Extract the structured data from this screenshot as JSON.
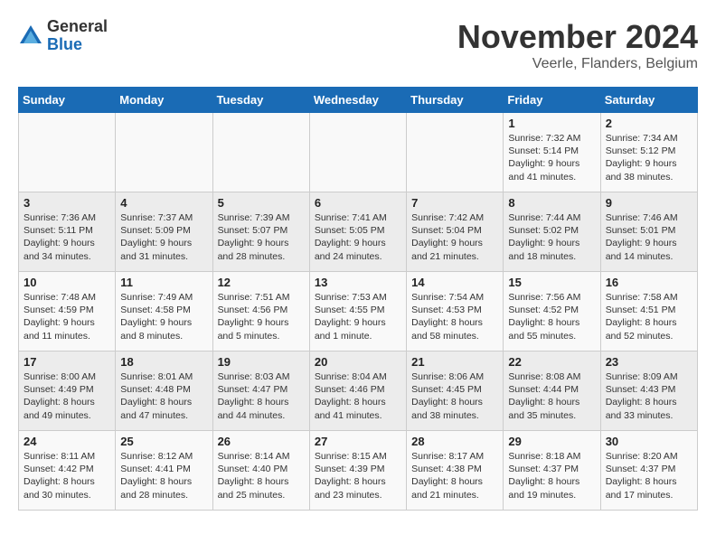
{
  "logo": {
    "general": "General",
    "blue": "Blue"
  },
  "title": "November 2024",
  "location": "Veerle, Flanders, Belgium",
  "weekdays": [
    "Sunday",
    "Monday",
    "Tuesday",
    "Wednesday",
    "Thursday",
    "Friday",
    "Saturday"
  ],
  "weeks": [
    [
      {
        "day": "",
        "detail": ""
      },
      {
        "day": "",
        "detail": ""
      },
      {
        "day": "",
        "detail": ""
      },
      {
        "day": "",
        "detail": ""
      },
      {
        "day": "",
        "detail": ""
      },
      {
        "day": "1",
        "detail": "Sunrise: 7:32 AM\nSunset: 5:14 PM\nDaylight: 9 hours\nand 41 minutes."
      },
      {
        "day": "2",
        "detail": "Sunrise: 7:34 AM\nSunset: 5:12 PM\nDaylight: 9 hours\nand 38 minutes."
      }
    ],
    [
      {
        "day": "3",
        "detail": "Sunrise: 7:36 AM\nSunset: 5:11 PM\nDaylight: 9 hours\nand 34 minutes."
      },
      {
        "day": "4",
        "detail": "Sunrise: 7:37 AM\nSunset: 5:09 PM\nDaylight: 9 hours\nand 31 minutes."
      },
      {
        "day": "5",
        "detail": "Sunrise: 7:39 AM\nSunset: 5:07 PM\nDaylight: 9 hours\nand 28 minutes."
      },
      {
        "day": "6",
        "detail": "Sunrise: 7:41 AM\nSunset: 5:05 PM\nDaylight: 9 hours\nand 24 minutes."
      },
      {
        "day": "7",
        "detail": "Sunrise: 7:42 AM\nSunset: 5:04 PM\nDaylight: 9 hours\nand 21 minutes."
      },
      {
        "day": "8",
        "detail": "Sunrise: 7:44 AM\nSunset: 5:02 PM\nDaylight: 9 hours\nand 18 minutes."
      },
      {
        "day": "9",
        "detail": "Sunrise: 7:46 AM\nSunset: 5:01 PM\nDaylight: 9 hours\nand 14 minutes."
      }
    ],
    [
      {
        "day": "10",
        "detail": "Sunrise: 7:48 AM\nSunset: 4:59 PM\nDaylight: 9 hours\nand 11 minutes."
      },
      {
        "day": "11",
        "detail": "Sunrise: 7:49 AM\nSunset: 4:58 PM\nDaylight: 9 hours\nand 8 minutes."
      },
      {
        "day": "12",
        "detail": "Sunrise: 7:51 AM\nSunset: 4:56 PM\nDaylight: 9 hours\nand 5 minutes."
      },
      {
        "day": "13",
        "detail": "Sunrise: 7:53 AM\nSunset: 4:55 PM\nDaylight: 9 hours\nand 1 minute."
      },
      {
        "day": "14",
        "detail": "Sunrise: 7:54 AM\nSunset: 4:53 PM\nDaylight: 8 hours\nand 58 minutes."
      },
      {
        "day": "15",
        "detail": "Sunrise: 7:56 AM\nSunset: 4:52 PM\nDaylight: 8 hours\nand 55 minutes."
      },
      {
        "day": "16",
        "detail": "Sunrise: 7:58 AM\nSunset: 4:51 PM\nDaylight: 8 hours\nand 52 minutes."
      }
    ],
    [
      {
        "day": "17",
        "detail": "Sunrise: 8:00 AM\nSunset: 4:49 PM\nDaylight: 8 hours\nand 49 minutes."
      },
      {
        "day": "18",
        "detail": "Sunrise: 8:01 AM\nSunset: 4:48 PM\nDaylight: 8 hours\nand 47 minutes."
      },
      {
        "day": "19",
        "detail": "Sunrise: 8:03 AM\nSunset: 4:47 PM\nDaylight: 8 hours\nand 44 minutes."
      },
      {
        "day": "20",
        "detail": "Sunrise: 8:04 AM\nSunset: 4:46 PM\nDaylight: 8 hours\nand 41 minutes."
      },
      {
        "day": "21",
        "detail": "Sunrise: 8:06 AM\nSunset: 4:45 PM\nDaylight: 8 hours\nand 38 minutes."
      },
      {
        "day": "22",
        "detail": "Sunrise: 8:08 AM\nSunset: 4:44 PM\nDaylight: 8 hours\nand 35 minutes."
      },
      {
        "day": "23",
        "detail": "Sunrise: 8:09 AM\nSunset: 4:43 PM\nDaylight: 8 hours\nand 33 minutes."
      }
    ],
    [
      {
        "day": "24",
        "detail": "Sunrise: 8:11 AM\nSunset: 4:42 PM\nDaylight: 8 hours\nand 30 minutes."
      },
      {
        "day": "25",
        "detail": "Sunrise: 8:12 AM\nSunset: 4:41 PM\nDaylight: 8 hours\nand 28 minutes."
      },
      {
        "day": "26",
        "detail": "Sunrise: 8:14 AM\nSunset: 4:40 PM\nDaylight: 8 hours\nand 25 minutes."
      },
      {
        "day": "27",
        "detail": "Sunrise: 8:15 AM\nSunset: 4:39 PM\nDaylight: 8 hours\nand 23 minutes."
      },
      {
        "day": "28",
        "detail": "Sunrise: 8:17 AM\nSunset: 4:38 PM\nDaylight: 8 hours\nand 21 minutes."
      },
      {
        "day": "29",
        "detail": "Sunrise: 8:18 AM\nSunset: 4:37 PM\nDaylight: 8 hours\nand 19 minutes."
      },
      {
        "day": "30",
        "detail": "Sunrise: 8:20 AM\nSunset: 4:37 PM\nDaylight: 8 hours\nand 17 minutes."
      }
    ]
  ]
}
